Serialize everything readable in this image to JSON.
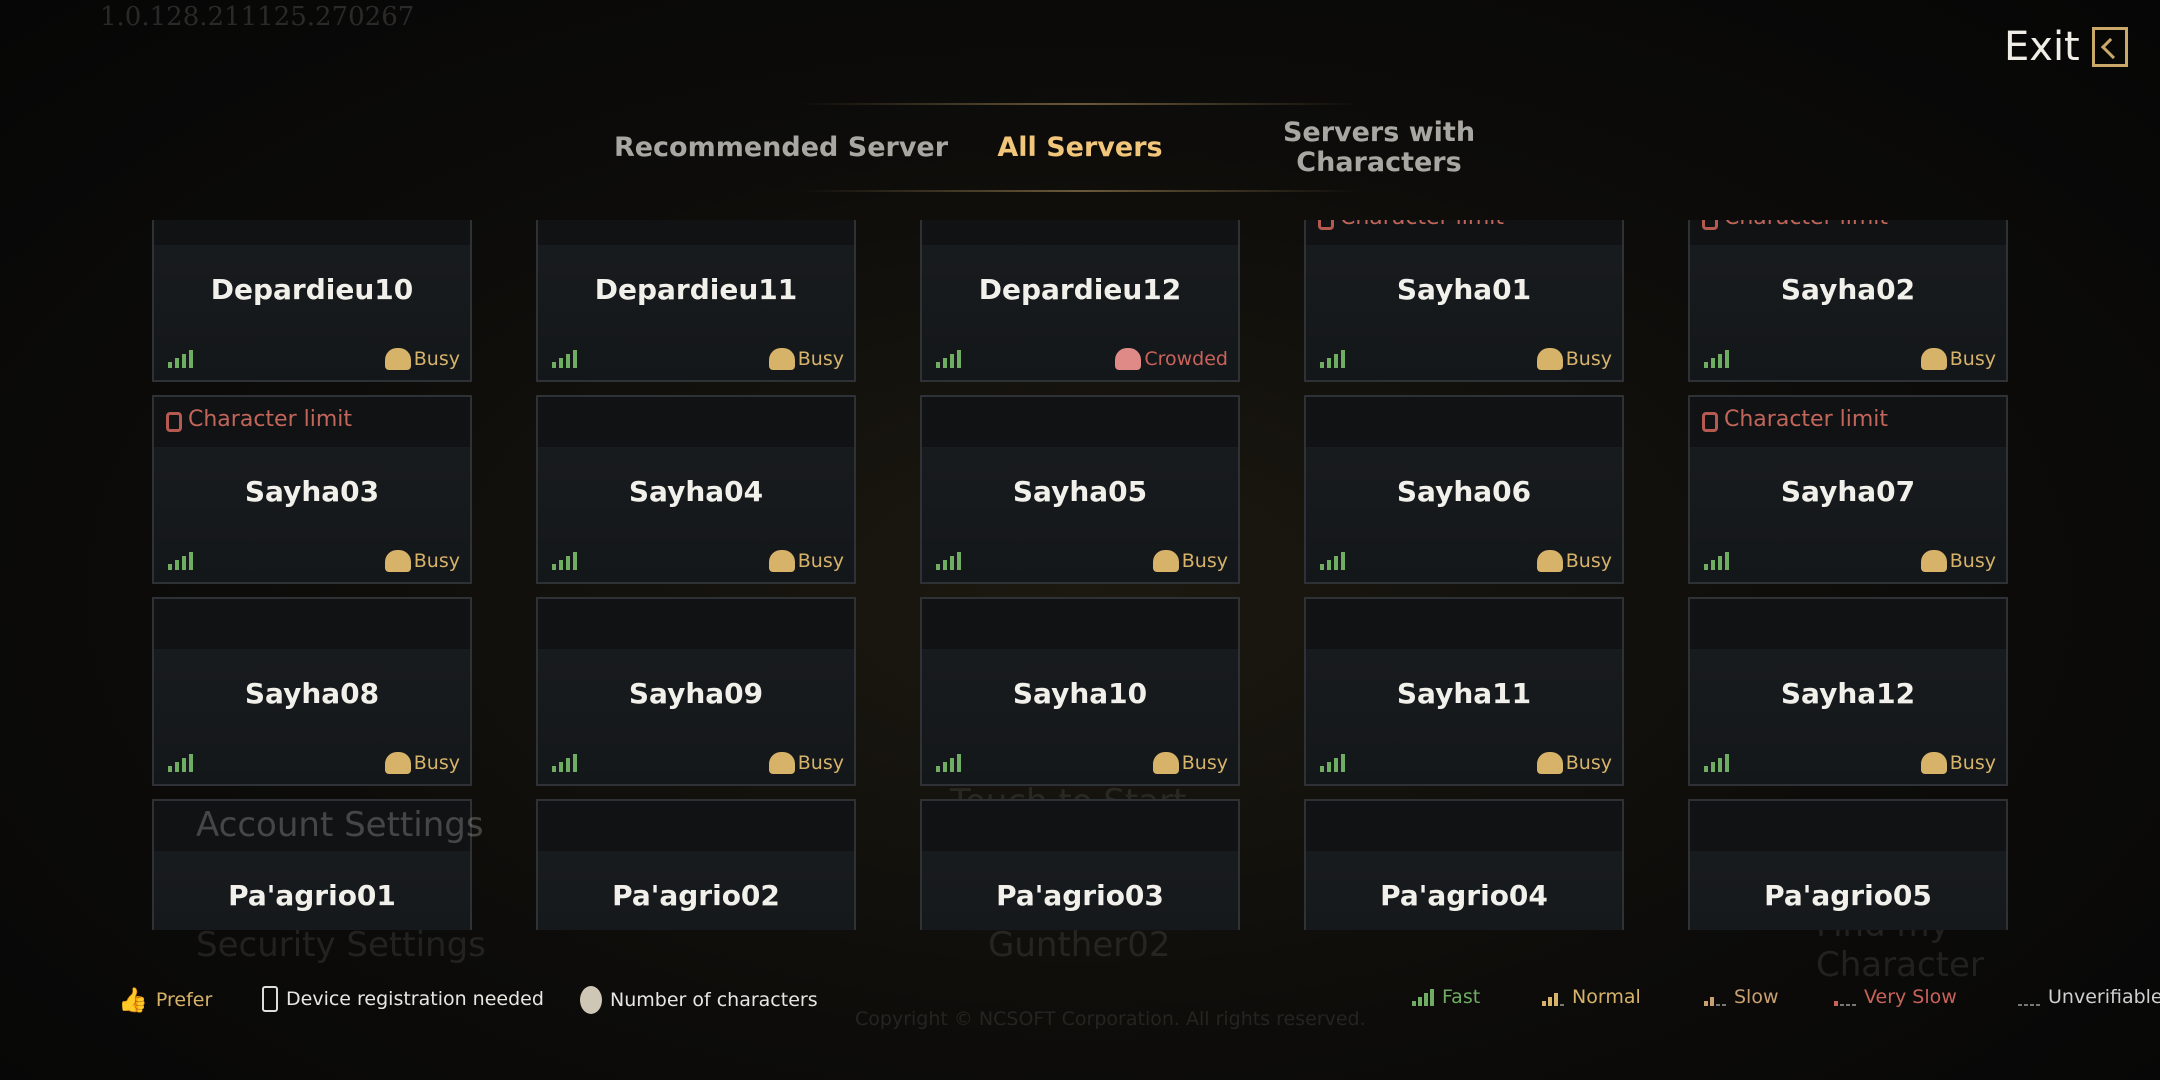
{
  "version": "1.0.128.211125.270267",
  "background": {
    "account_settings": "Account Settings",
    "security_settings": "Security Settings",
    "touch_to_start": "Touch to Start",
    "server": "Gunther02",
    "find_character": "Find my Character",
    "copyright": "Copyright © NCSOFT Corporation. All rights reserved."
  },
  "exit": {
    "label": "Exit",
    "icon": "exit-door-icon"
  },
  "tabs": [
    {
      "label": "Recommended Server",
      "active": false
    },
    {
      "label": "All Servers",
      "active": true
    },
    {
      "label": "Servers with Characters",
      "active": false
    }
  ],
  "colors": {
    "accent": "#f2c67a",
    "fast": "#6fae62",
    "busy": "#d7b36a",
    "crowded": "#c9625a",
    "limit": "#c2655a"
  },
  "servers": [
    {
      "name": "Depardieu10",
      "status": "Busy",
      "limit": false
    },
    {
      "name": "Depardieu11",
      "status": "Busy",
      "limit": false
    },
    {
      "name": "Depardieu12",
      "status": "Crowded",
      "limit": false
    },
    {
      "name": "Sayha01",
      "status": "Busy",
      "limit": true
    },
    {
      "name": "Sayha02",
      "status": "Busy",
      "limit": true
    },
    {
      "name": "Sayha03",
      "status": "Busy",
      "limit": true
    },
    {
      "name": "Sayha04",
      "status": "Busy",
      "limit": false
    },
    {
      "name": "Sayha05",
      "status": "Busy",
      "limit": false
    },
    {
      "name": "Sayha06",
      "status": "Busy",
      "limit": false
    },
    {
      "name": "Sayha07",
      "status": "Busy",
      "limit": true
    },
    {
      "name": "Sayha08",
      "status": "Busy",
      "limit": false
    },
    {
      "name": "Sayha09",
      "status": "Busy",
      "limit": false
    },
    {
      "name": "Sayha10",
      "status": "Busy",
      "limit": false
    },
    {
      "name": "Sayha11",
      "status": "Busy",
      "limit": false
    },
    {
      "name": "Sayha12",
      "status": "Busy",
      "limit": false
    },
    {
      "name": "Pa'agrio01",
      "status": "",
      "limit": false
    },
    {
      "name": "Pa'agrio02",
      "status": "",
      "limit": false
    },
    {
      "name": "Pa'agrio03",
      "status": "",
      "limit": false
    },
    {
      "name": "Pa'agrio04",
      "status": "",
      "limit": false
    },
    {
      "name": "Pa'agrio05",
      "status": "",
      "limit": false
    }
  ],
  "limit_label": "Character limit",
  "legend": {
    "prefer": "Prefer",
    "device": "Device registration needed",
    "characters": "Number of characters",
    "speeds": [
      {
        "label": "Fast",
        "color": "#6fae62",
        "bars": 4
      },
      {
        "label": "Normal",
        "color": "#d7b36a",
        "bars": 3
      },
      {
        "label": "Slow",
        "color": "#c9a070",
        "bars": 2
      },
      {
        "label": "Very Slow",
        "color": "#c9625a",
        "bars": 1
      },
      {
        "label": "Unverifiable",
        "color": "#8a8a8a",
        "bars": 0
      }
    ]
  }
}
